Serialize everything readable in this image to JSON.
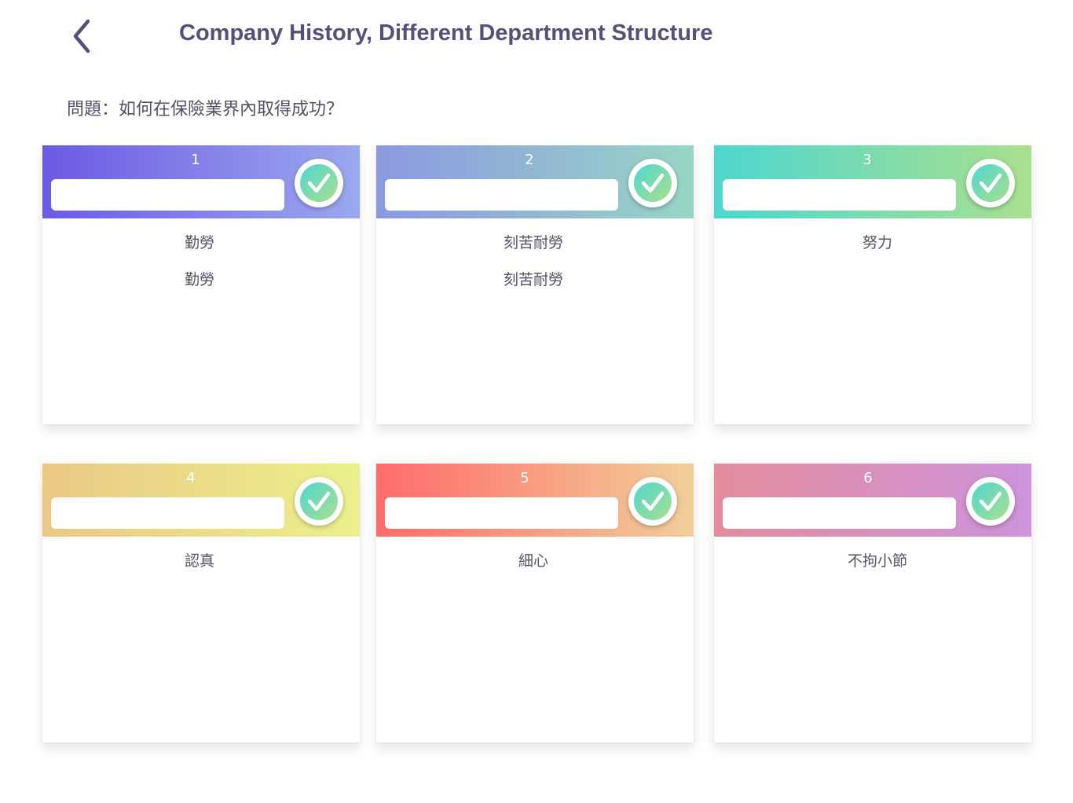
{
  "header": {
    "title": "Company History, Different Department Structure",
    "back_icon": "chevron-left-icon"
  },
  "question": "問題：如何在保險業界內取得成功？",
  "colors": {
    "title": "#55507a",
    "text": "#555066",
    "check_gradient": [
      "#4ed6cf",
      "#a9e08e"
    ]
  },
  "cards": [
    {
      "number": "1",
      "input_value": "",
      "answers": [
        "勤勞",
        "勤勞"
      ],
      "check_icon": "check-circle-icon",
      "gradient": [
        "#6c5ae4",
        "#9ba8ee"
      ]
    },
    {
      "number": "2",
      "input_value": "",
      "answers": [
        "刻苦耐勞",
        "刻苦耐勞"
      ],
      "check_icon": "check-circle-icon",
      "gradient": [
        "#8b99e0",
        "#97d6c5"
      ]
    },
    {
      "number": "3",
      "input_value": "",
      "answers": [
        "努力"
      ],
      "check_icon": "check-circle-icon",
      "gradient": [
        "#4ed6cf",
        "#a9e08e"
      ]
    },
    {
      "number": "4",
      "input_value": "",
      "answers": [
        "認真"
      ],
      "check_icon": "check-circle-icon",
      "gradient": [
        "#ebc884",
        "#ebf08c"
      ]
    },
    {
      "number": "5",
      "input_value": "",
      "answers": [
        "細心"
      ],
      "check_icon": "check-circle-icon",
      "gradient": [
        "#ff6b6b",
        "#f1cf99"
      ]
    },
    {
      "number": "6",
      "input_value": "",
      "answers": [
        "不拘小節"
      ],
      "check_icon": "check-circle-icon",
      "gradient": [
        "#e48c9c",
        "#cd93dc"
      ]
    }
  ]
}
